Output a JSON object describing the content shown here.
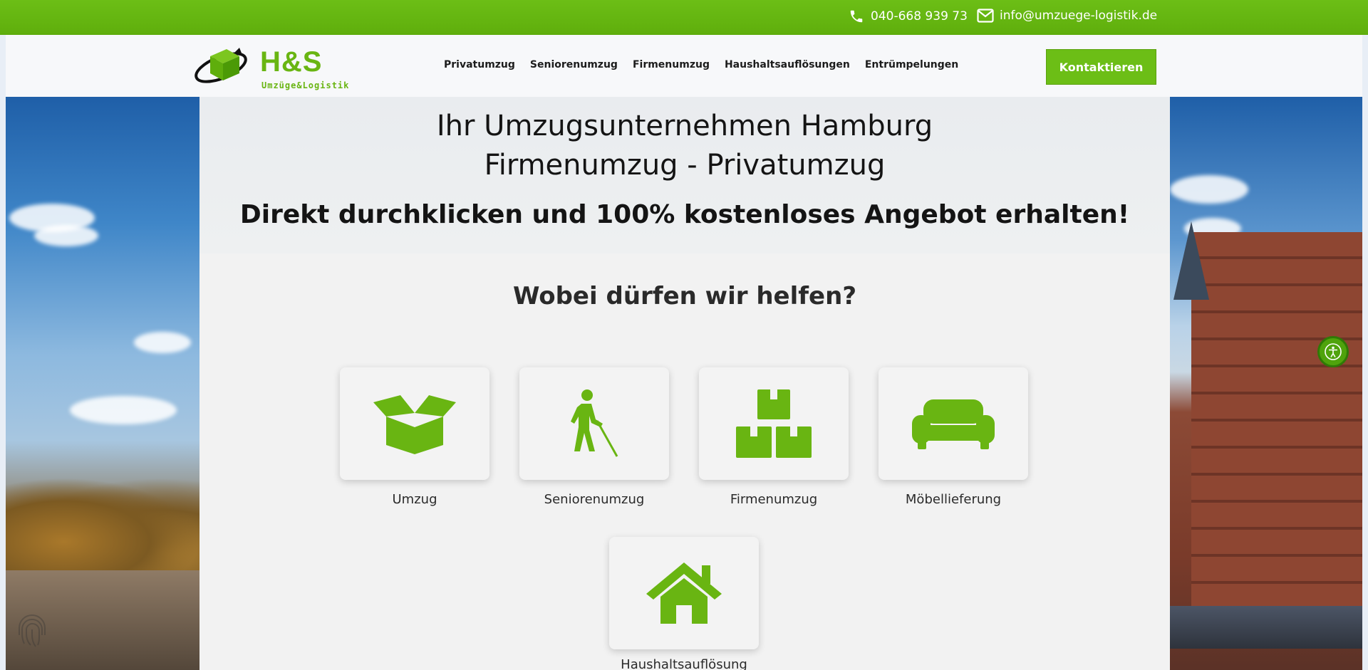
{
  "topbar": {
    "phone": "040-668 939 73",
    "email": "info@umzuege-logistik.de",
    "phone_icon": "phone-icon",
    "email_icon": "envelope-icon"
  },
  "header": {
    "logo": {
      "brand": "H&S",
      "tagline": "Umzüge&Logistik"
    },
    "nav": [
      "Privatumzug",
      "Seniorenumzug",
      "Firmenumzug",
      "Haushaltsauflösungen",
      "Entrümpelungen"
    ],
    "cta": "Kontaktieren"
  },
  "hero": {
    "title_line1": "Ihr Umzugsunternehmen Hamburg",
    "title_line2": "Firmenumzug - Privatumzug",
    "subtitle": "Direkt durchklicken und 100% kostenloses Angebot erhalten!"
  },
  "services": {
    "title": "Wobei dürfen wir helfen?",
    "items": [
      {
        "label": "Umzug",
        "icon": "box-open-icon"
      },
      {
        "label": "Seniorenumzug",
        "icon": "person-with-cane-icon"
      },
      {
        "label": "Firmenumzug",
        "icon": "stacked-boxes-icon"
      },
      {
        "label": "Möbellieferung",
        "icon": "couch-icon"
      },
      {
        "label": "Haushaltsauflösung",
        "icon": "house-icon"
      }
    ]
  },
  "colors": {
    "brand_green": "#6cbe16",
    "text_dark": "#141414"
  },
  "widgets": {
    "accessibility": "accessibility-icon"
  }
}
